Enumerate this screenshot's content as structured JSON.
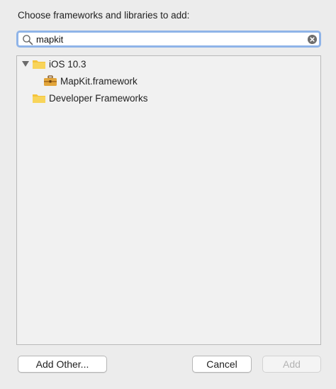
{
  "dialog": {
    "prompt": "Choose frameworks and libraries to add:"
  },
  "search": {
    "value": "mapkit",
    "placeholder": ""
  },
  "tree": {
    "items": [
      {
        "label": "iOS 10.3",
        "icon": "folder-icon",
        "expanded": true
      },
      {
        "label": "MapKit.framework",
        "icon": "toolbox-icon"
      },
      {
        "label": "Developer Frameworks",
        "icon": "folder-icon"
      }
    ]
  },
  "buttons": {
    "add_other": "Add Other...",
    "cancel": "Cancel",
    "add": "Add"
  },
  "colors": {
    "window_bg": "#ececec",
    "focus_ring": "#8fb4e8",
    "folder_yellow": "#f4c33b",
    "disabled_text": "#b3b3b3"
  }
}
